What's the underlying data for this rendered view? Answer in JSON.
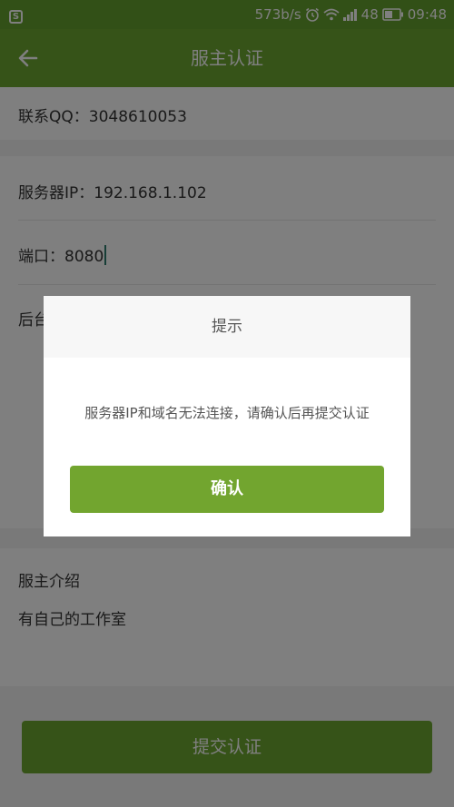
{
  "status_bar": {
    "left_icon": "S",
    "speed": "573b/s",
    "battery_level": "48",
    "time": "09:48",
    "icons": [
      "alarm-icon",
      "wifi-icon",
      "signal-icon",
      "battery-icon"
    ]
  },
  "app_bar": {
    "back_icon": "arrow-left-icon",
    "title": "服主认证"
  },
  "form": {
    "contact_qq": "联系QQ：3048610053",
    "server_ip": "服务器IP：192.168.1.102",
    "port_label": "端口：",
    "port_value": "8080",
    "backend_partial": "后台",
    "intro_label": "服主介绍",
    "intro_value": "有自己的工作室"
  },
  "submit_label": "提交认证",
  "dialog": {
    "title": "提示",
    "message": "服务器IP和域名无法连接，请确认后再提交认证",
    "confirm_label": "确认"
  },
  "colors": {
    "primary": "#6ca630",
    "dialog_button": "#72a52f"
  }
}
